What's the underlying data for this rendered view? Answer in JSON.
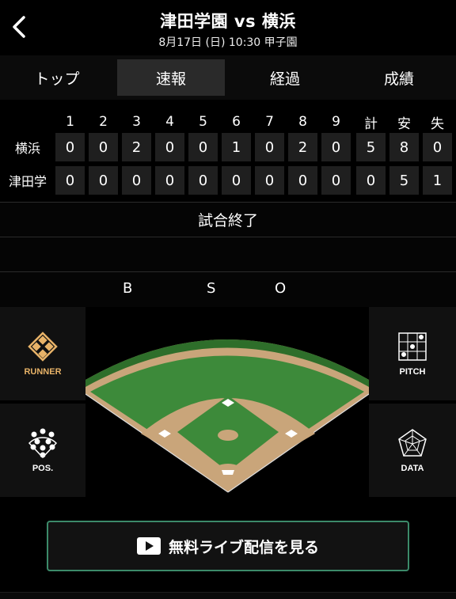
{
  "header": {
    "title": "津田学園 vs 横浜",
    "subtitle": "8月17日 (日) 10:30 甲子園"
  },
  "tabs": [
    {
      "label": "トップ",
      "active": false
    },
    {
      "label": "速報",
      "active": true
    },
    {
      "label": "経過",
      "active": false
    },
    {
      "label": "成績",
      "active": false
    }
  ],
  "scoreboard": {
    "columns": [
      "1",
      "2",
      "3",
      "4",
      "5",
      "6",
      "7",
      "8",
      "9",
      "計",
      "安",
      "失"
    ],
    "rows": [
      {
        "team": "横浜",
        "values": [
          "0",
          "0",
          "2",
          "0",
          "0",
          "1",
          "0",
          "2",
          "0",
          "5",
          "8",
          "0"
        ]
      },
      {
        "team": "津田学",
        "values": [
          "0",
          "0",
          "0",
          "0",
          "0",
          "0",
          "0",
          "0",
          "0",
          "0",
          "5",
          "1"
        ]
      }
    ]
  },
  "status": "試合終了",
  "count": {
    "b": "B",
    "s": "S",
    "o": "O"
  },
  "side_buttons": {
    "runner": "RUNNER",
    "pitch": "PITCH",
    "pos": "POS.",
    "data": "DATA"
  },
  "live": {
    "label": "無料ライブ配信を見る"
  },
  "colors": {
    "runner_accent": "#e8b368",
    "live_border": "#3c8a6a",
    "field_grass": "#3d8a3a",
    "field_dirt": "#c9a57a"
  }
}
